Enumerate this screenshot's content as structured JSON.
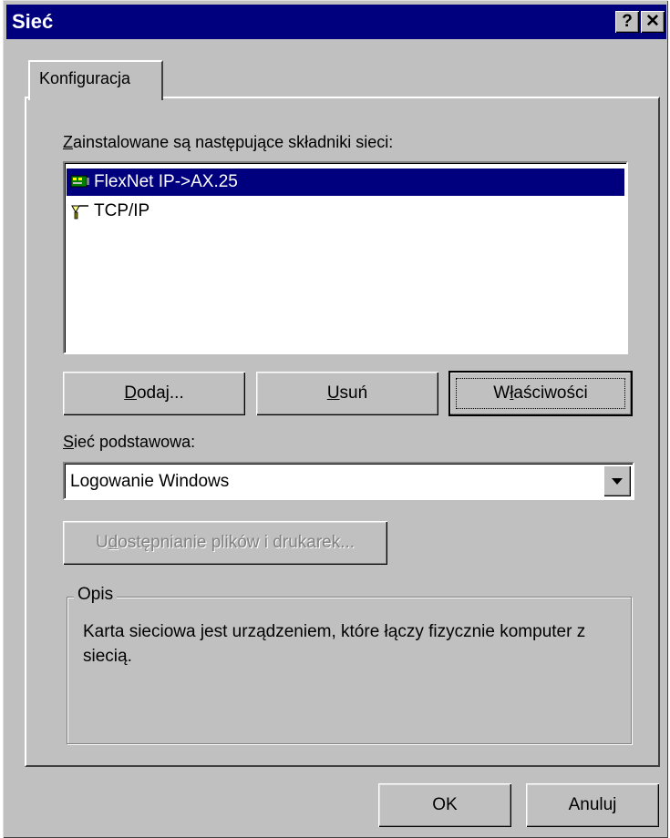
{
  "window": {
    "title": "Sieć",
    "help_glyph": "?",
    "close_glyph": "✕"
  },
  "tab": {
    "label": "Konfiguracja"
  },
  "components": {
    "label_first": "Z",
    "label_rest": "ainstalowane są następujące składniki sieci:",
    "items": [
      {
        "label": "FlexNet IP->AX.25",
        "icon": "network-adapter-icon",
        "selected": true
      },
      {
        "label": "TCP/IP",
        "icon": "protocol-icon",
        "selected": false
      }
    ]
  },
  "buttons": {
    "add_u": "D",
    "add_rest": "odaj...",
    "remove_u": "U",
    "remove_rest": "suń",
    "props_pre": "W",
    "props_u": "ł",
    "props_rest": "aściwości"
  },
  "primary": {
    "label_first": "S",
    "label_rest": "ieć podstawowa:",
    "value": "Logowanie Windows"
  },
  "sharing": {
    "label_pre": "U",
    "label_u": "d",
    "label_rest": "ostępnianie plików i drukarek..."
  },
  "description": {
    "title": "Opis",
    "text": "Karta sieciowa jest urządzeniem, które łączy fizycznie komputer z siecią."
  },
  "footer": {
    "ok_label": "OK",
    "cancel_label": "Anuluj"
  },
  "colors": {
    "titlebar": "#00007f",
    "face": "#c0c0c0",
    "selection": "#00007f"
  }
}
